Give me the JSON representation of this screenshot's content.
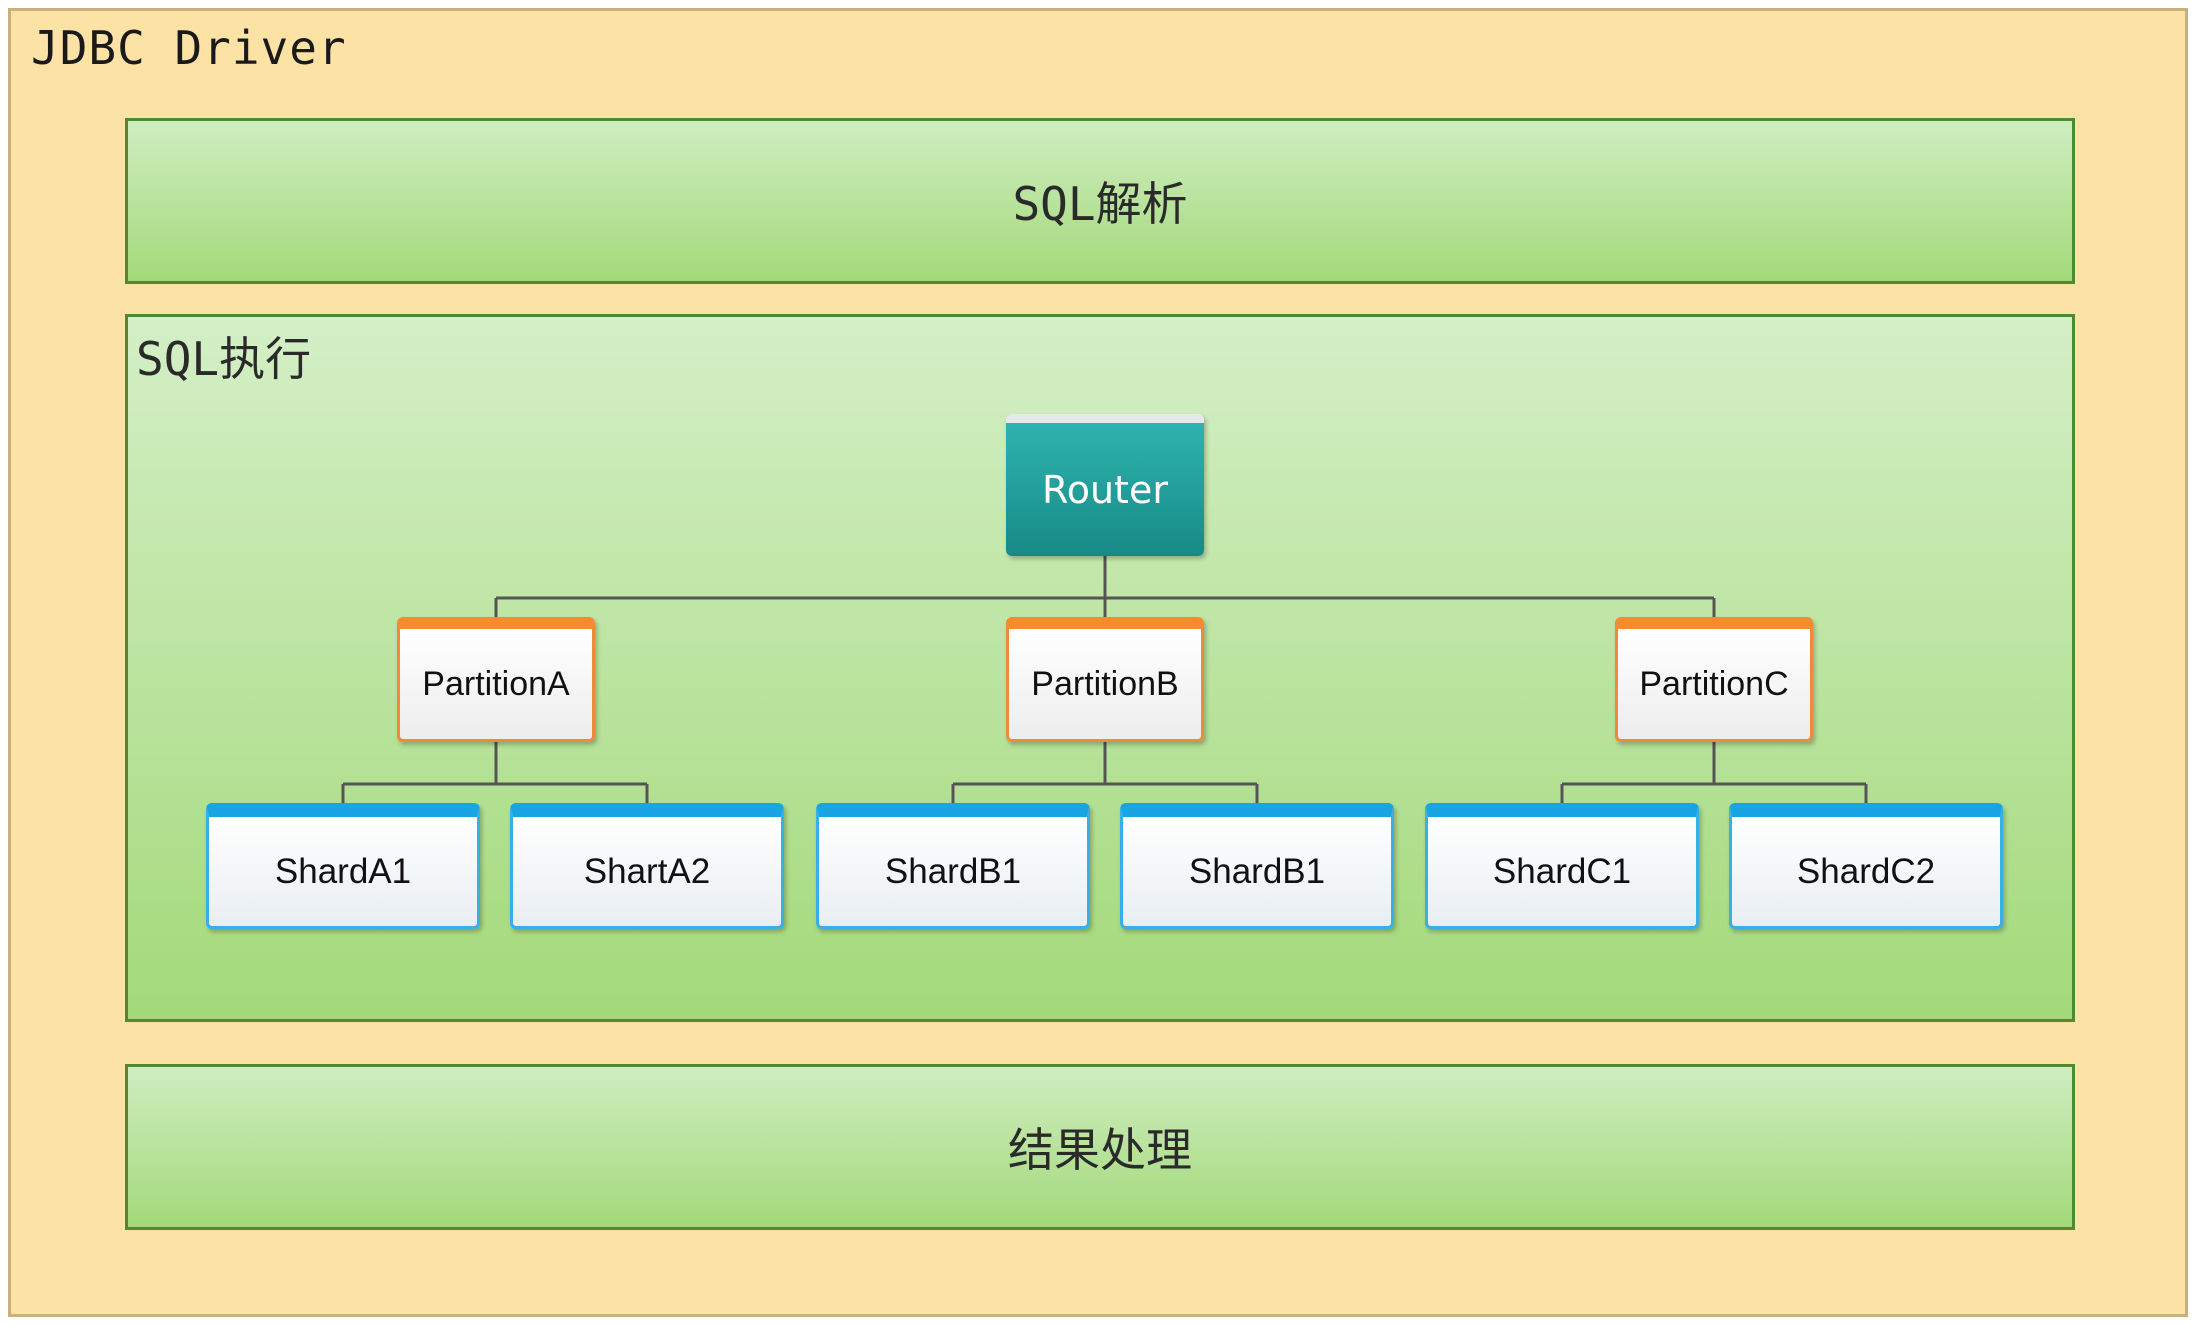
{
  "driver": {
    "title": "JDBC Driver"
  },
  "parse": {
    "label": "SQL解析"
  },
  "exec": {
    "title": "SQL执行",
    "router": "Router",
    "partitions": [
      "PartitionA",
      "PartitionB",
      "PartitionC"
    ],
    "shards": [
      "ShardA1",
      "ShartA2",
      "ShardB1",
      "ShardB1",
      "ShardC1",
      "ShardC2"
    ]
  },
  "result": {
    "label": "结果处理"
  }
}
